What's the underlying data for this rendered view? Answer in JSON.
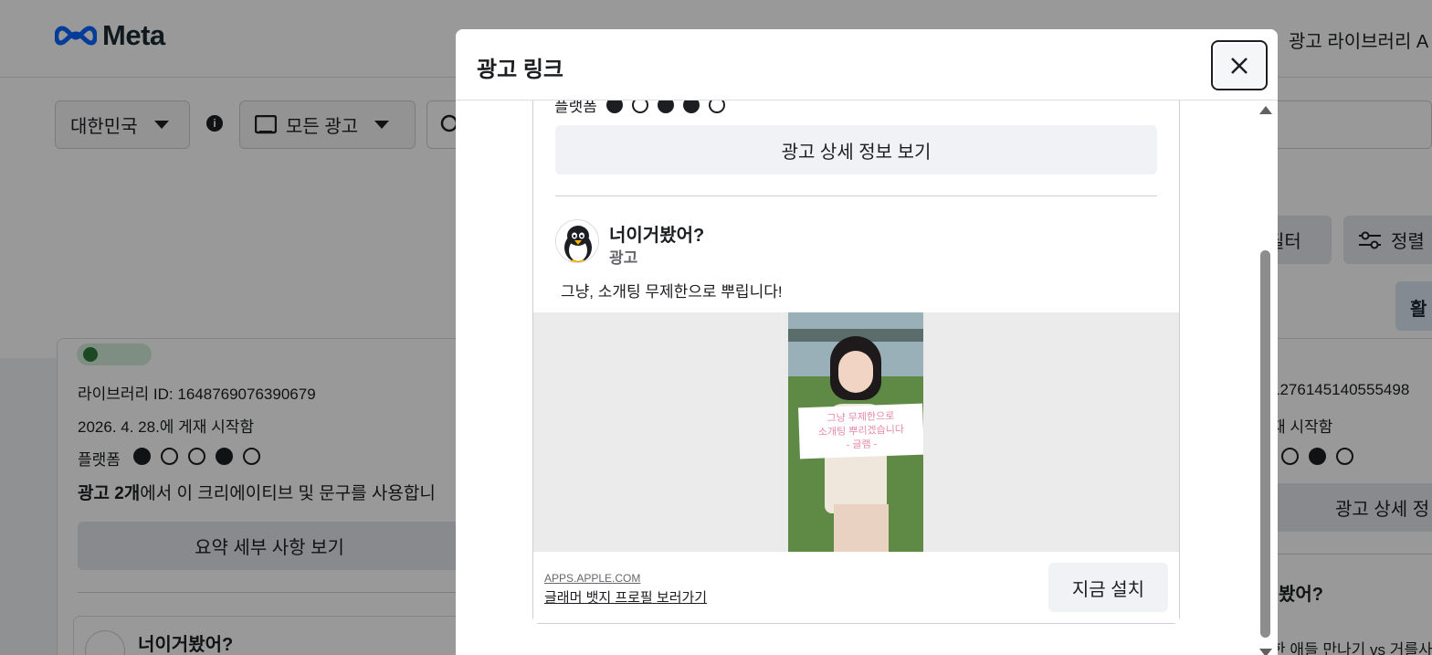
{
  "header": {
    "logo_text": "Meta",
    "top_right_link": "광고 라이브러리 A"
  },
  "filters": {
    "country": "대한민국",
    "ad_category": "모든 광고"
  },
  "toolbar": {
    "filter_label": "필터",
    "sort_label": "정렬",
    "active_chip": "활"
  },
  "background_card_left": {
    "library_id": "라이브러리 ID: 1648769076390679",
    "start_date": "2026. 4. 28.에 게재 시작함",
    "platform_label": "플랫폼",
    "usage_bold": "광고 2개",
    "usage_rest": "에서 이 크리에이티브 및 문구를 사용합니",
    "summary_button": "요약 세부 사항 보기",
    "page_name": "너이거봤어?"
  },
  "background_card_right": {
    "library_id_fragment": "1276145140555498",
    "start_fragment": "재 시작함",
    "details_fragment": "광고 상세 정",
    "page_name_fragment": "봤어?",
    "copy_fragment": "한 애들 만나기 vs 거를사"
  },
  "modal": {
    "title": "광고 링크",
    "close_label": "×",
    "platform_label_partial": "플랫폼",
    "details_button": "광고 상세 정보 보기",
    "ad": {
      "page_name": "너이거봤어?",
      "sponsored_label": "광고",
      "body_text": "그냥, 소개팅 무제한으로 뿌립니다!",
      "image_sign_text": [
        "그냥 무제한으로",
        "소개팅 뿌리겠습니다",
        "- 글램 -"
      ],
      "cta_domain": "APPS.APPLE.COM",
      "cta_title": "글래머 뱃지 프로필 보러가기",
      "cta_button": "지금 설치"
    }
  },
  "colors": {
    "overlay": "#000000",
    "meta_blue": "#0866ff",
    "button_bg": "#f0f2f5",
    "border": "#ccd0d5"
  },
  "icons": [
    "meta-logo-icon",
    "info-icon",
    "monitor-icon",
    "search-icon",
    "filter-sliders-icon",
    "facebook-icon",
    "instagram-icon",
    "audience-network-icon",
    "messenger-icon",
    "threads-icon",
    "close-icon",
    "scroll-up-arrow-icon",
    "scroll-down-arrow-icon"
  ]
}
